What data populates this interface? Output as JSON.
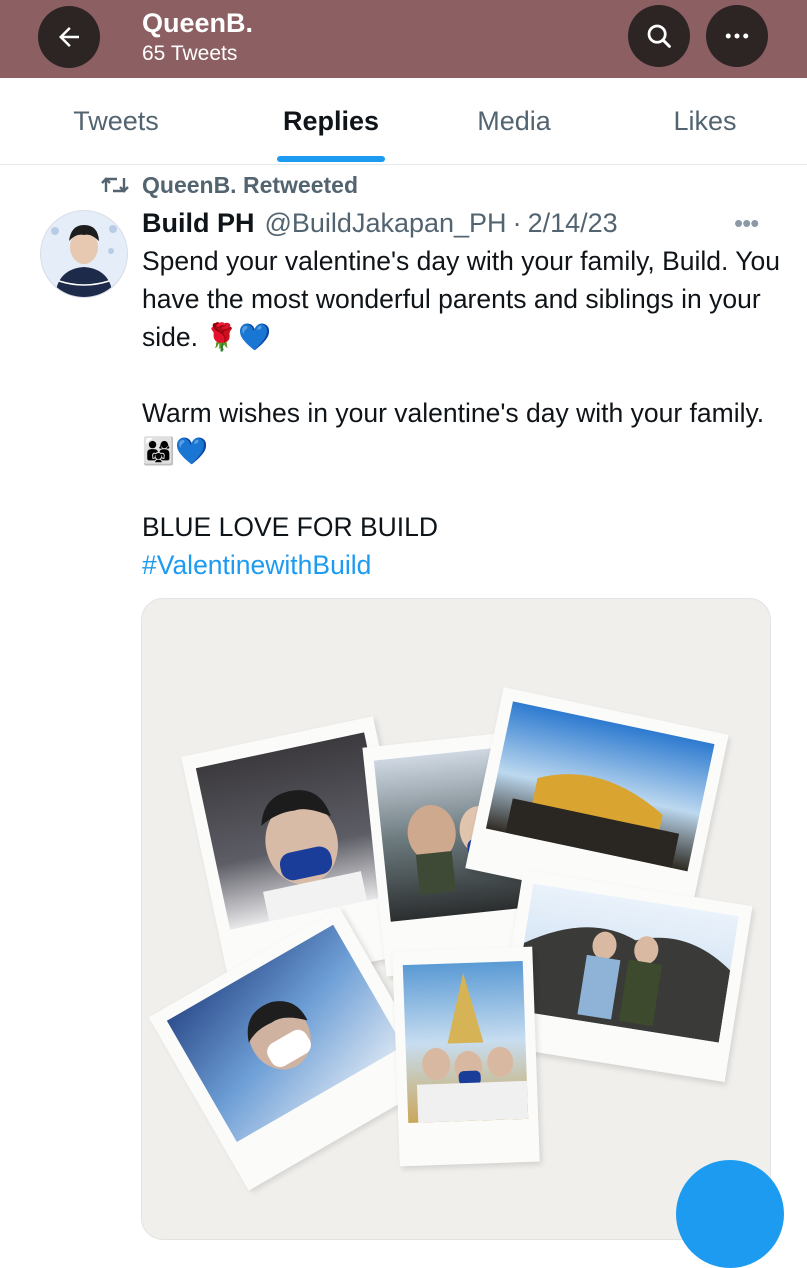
{
  "header": {
    "title": "QueenB.",
    "subtitle": "65 Tweets",
    "back_icon": "arrow-left-icon",
    "search_icon": "search-icon",
    "more_icon": "more-icon"
  },
  "tabs": [
    {
      "label": "Tweets"
    },
    {
      "label": "Replies",
      "active": true
    },
    {
      "label": "Media"
    },
    {
      "label": "Likes"
    }
  ],
  "tweet": {
    "retweeted_by": "QueenB. Retweeted",
    "author_name": "Build PH",
    "author_handle": "@BuildJakapan_PH",
    "separator": "·",
    "date": "2/14/23",
    "more": "•••",
    "lines": {
      "p1": "Spend your valentine's day with your family, Build. You have the most wonderful parents and siblings in your side. 🌹💙",
      "p2": "Warm wishes in your valentine's day with your family. 👨‍👩‍👧💙",
      "p3": "BLUE LOVE FOR BUILD",
      "hashtag": "#ValentinewithBuild"
    }
  },
  "colors": {
    "header_bg": "#8c5f62",
    "accent": "#1d9bf0",
    "muted_text": "#536471"
  }
}
